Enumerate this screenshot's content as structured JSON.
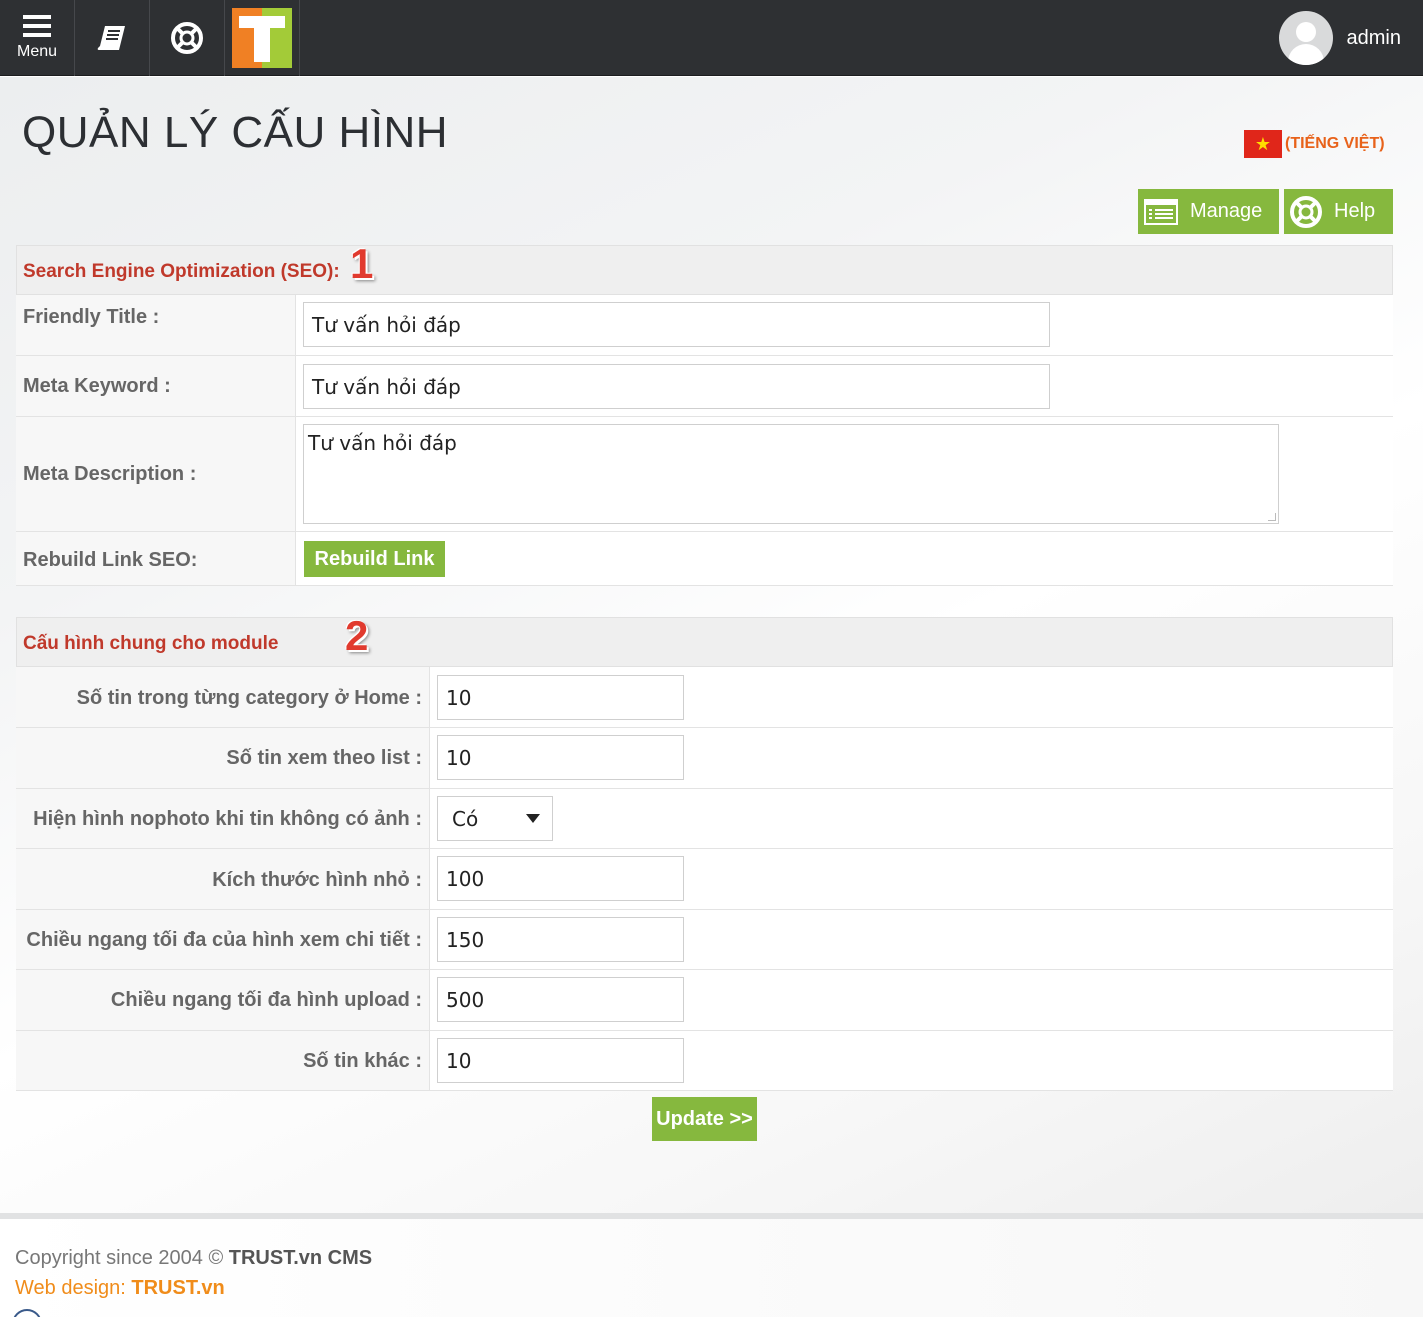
{
  "topbar": {
    "menu_label": "Menu",
    "user_name": "admin"
  },
  "page": {
    "title": "QUẢN LÝ CẤU HÌNH",
    "language": "(TIẾNG VIỆT)"
  },
  "actions": {
    "manage_label": "Manage",
    "help_label": "Help"
  },
  "seo": {
    "title": "Search Engine Optimization (SEO):",
    "number": "1",
    "friendly_title_label": "Friendly Title :",
    "friendly_title_value": "Tư vấn hỏi đáp",
    "meta_keyword_label": "Meta Keyword :",
    "meta_keyword_value": "Tư vấn hỏi đáp",
    "meta_description_label": "Meta Description :",
    "meta_description_value": "Tư vấn hỏi đáp",
    "rebuild_label": "Rebuild Link SEO:",
    "rebuild_button": "Rebuild Link"
  },
  "module": {
    "title": "Cấu hình chung cho module",
    "number": "2",
    "rows": [
      {
        "label": "Số tin trong từng category ở Home :",
        "value": "10",
        "type": "input"
      },
      {
        "label": "Số tin xem theo list :",
        "value": "10",
        "type": "input"
      },
      {
        "label": "Hiện hình nophoto khi tin không có ảnh :",
        "value": "Có",
        "type": "select"
      },
      {
        "label": "Kích thước hình nhỏ :",
        "value": "100",
        "type": "input"
      },
      {
        "label": "Chiều ngang tối đa của hình xem chi tiết :",
        "value": "150",
        "type": "input"
      },
      {
        "label": "Chiều ngang tối đa hình upload :",
        "value": "500",
        "type": "input"
      },
      {
        "label": "Số tin khác :",
        "value": "10",
        "type": "input"
      }
    ],
    "update_button": "Update >>"
  },
  "footer": {
    "copyright_prefix": "Copyright since 2004 © ",
    "copyright_brand": "TRUST.vn CMS",
    "webdesign_prefix": "Web design: ",
    "webdesign_brand": "TRUST.vn"
  },
  "colors": {
    "topbar": "#2e3033",
    "accent_green": "#86b83e",
    "section_title": "#c0392b",
    "language": "#e8621a",
    "footer_link": "#f08c1a"
  }
}
